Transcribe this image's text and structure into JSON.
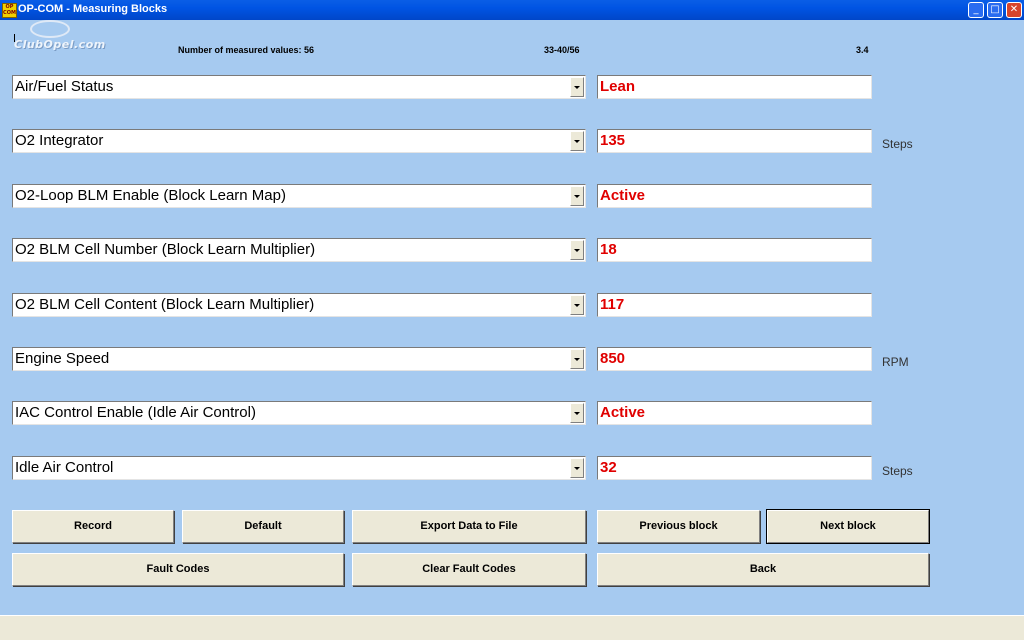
{
  "window": {
    "title": "OP-COM - Measuring Blocks",
    "icon_text": "OP COM",
    "minimize_glyph": "_",
    "maximize_glyph": "□",
    "close_glyph": "✕"
  },
  "logo": {
    "text": "ClubOpel.com"
  },
  "header": {
    "count_label": "Number of measured values: 56",
    "range": "33-40/56",
    "version": "3.4"
  },
  "rows": [
    {
      "parameter": "Air/Fuel Status",
      "value": "Lean",
      "unit": ""
    },
    {
      "parameter": "O2 Integrator",
      "value": "135",
      "unit": "Steps"
    },
    {
      "parameter": "O2-Loop BLM Enable (Block Learn Map)",
      "value": "Active",
      "unit": ""
    },
    {
      "parameter": "O2 BLM Cell Number (Block Learn Multiplier)",
      "value": "18",
      "unit": ""
    },
    {
      "parameter": "O2 BLM Cell Content (Block Learn Multiplier)",
      "value": "117",
      "unit": ""
    },
    {
      "parameter": "Engine Speed",
      "value": "850",
      "unit": "RPM"
    },
    {
      "parameter": "IAC Control Enable (Idle Air Control)",
      "value": "Active",
      "unit": ""
    },
    {
      "parameter": "Idle Air Control",
      "value": "32",
      "unit": "Steps"
    }
  ],
  "buttons": {
    "record": "Record",
    "default": "Default",
    "export": "Export Data to File",
    "previous_block": "Previous block",
    "next_block": "Next block",
    "fault_codes": "Fault Codes",
    "clear_fault_codes": "Clear Fault Codes",
    "back": "Back"
  },
  "colors": {
    "background": "#a6caf0",
    "value_text": "#e00000",
    "titlebar": "#0054e3"
  }
}
